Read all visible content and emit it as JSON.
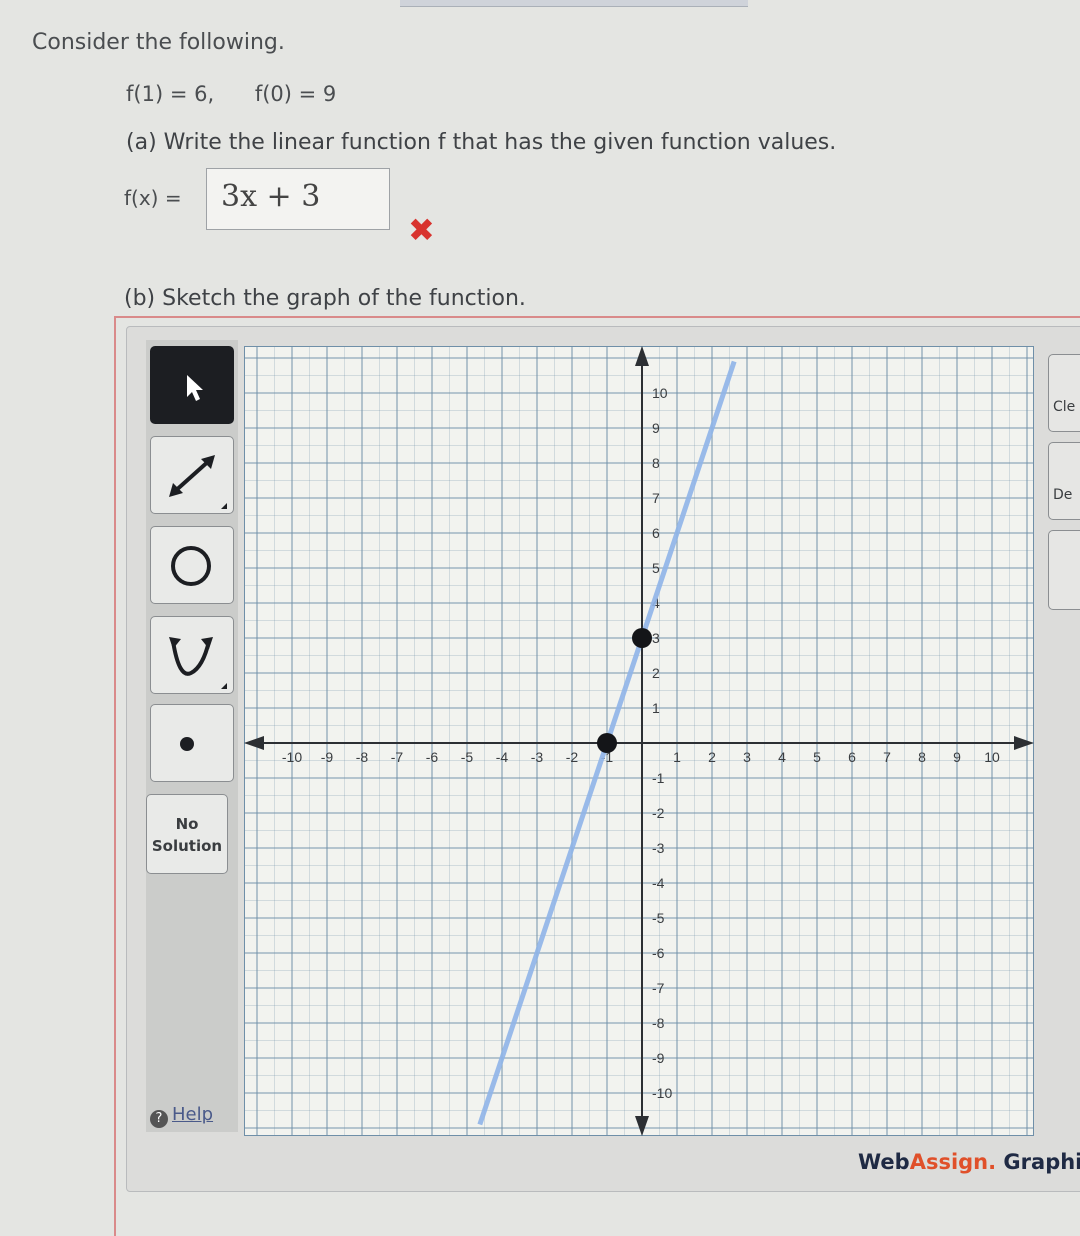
{
  "question": {
    "intro": "Consider the following.",
    "given_1": "f(1) = 6,",
    "given_2": "f(0) = 9",
    "part_a": "(a) Write the linear function f that has the given function values.",
    "fx_label": "f(x) =",
    "answer_value": "3x + 3",
    "answer_status": "incorrect",
    "part_b": "(b) Sketch the graph of the function."
  },
  "toolbar": {
    "tools": [
      {
        "name": "pointer-tool",
        "icon": "arrow-cursor-icon",
        "active": true
      },
      {
        "name": "line-tool",
        "icon": "line-segment-icon",
        "active": false
      },
      {
        "name": "circle-tool",
        "icon": "circle-icon",
        "active": false
      },
      {
        "name": "parabola-tool",
        "icon": "parabola-icon",
        "active": false
      },
      {
        "name": "point-tool",
        "icon": "point-icon",
        "active": false
      }
    ],
    "no_solution": [
      "No",
      "Solution"
    ],
    "help": "Help"
  },
  "side_buttons": {
    "clear": "Cle",
    "delete": "De",
    "third": ""
  },
  "graph": {
    "x_range": [
      -10,
      10
    ],
    "y_range": [
      -10,
      10
    ],
    "x_ticks": [
      "-10",
      "-9",
      "-8",
      "-7",
      "-6",
      "-5",
      "-4",
      "-3",
      "-2",
      "-1",
      "1",
      "2",
      "3",
      "4",
      "5",
      "6",
      "7",
      "8",
      "9",
      "10"
    ],
    "y_ticks": [
      "10",
      "9",
      "8",
      "7",
      "6",
      "5",
      "4",
      "3",
      "2",
      "1",
      "-1",
      "-2",
      "-3",
      "-4",
      "-5",
      "-6",
      "-7",
      "-8",
      "-9",
      "-10"
    ],
    "points": [
      {
        "x": 0,
        "y": 3
      },
      {
        "x": -1,
        "y": 0
      }
    ],
    "line_slope": 3,
    "line_intercept": 3,
    "line_color": "#8fb4e8",
    "grid_color": "#6f8fa8"
  },
  "brand": {
    "part1": "Web",
    "part2": "Assign.",
    "part3": " Graphing"
  }
}
